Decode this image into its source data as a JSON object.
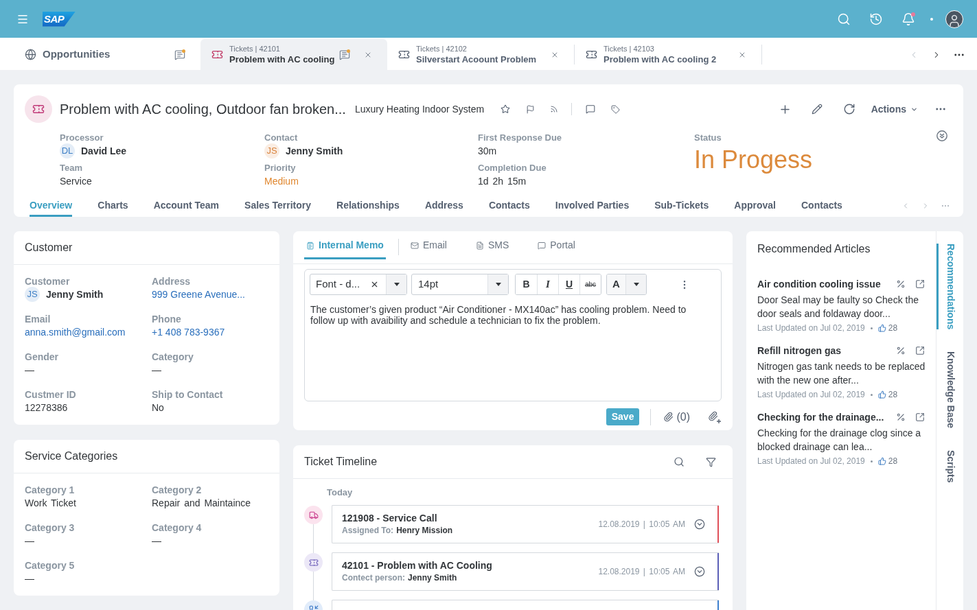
{
  "shell": {
    "logo": "SAP",
    "unread_notifications": true
  },
  "open_tabs": [
    {
      "kind": "home",
      "title": "Opportunities",
      "chat": true,
      "closable": false,
      "selected": false
    },
    {
      "kind": "ticket",
      "overline": "Tickets | 42101",
      "title": "Problem with AC cooling",
      "chat": true,
      "closable": true,
      "selected": true
    },
    {
      "kind": "ticket",
      "overline": "Tickets | 42102",
      "title": "Silverstart Acoount Problem",
      "chat": false,
      "closable": true,
      "selected": false
    },
    {
      "kind": "ticket",
      "overline": "Tickets | 42103",
      "title": "Problem with AC cooling 2",
      "chat": false,
      "closable": true,
      "selected": false
    }
  ],
  "tab_nav": {
    "prev_disabled": true,
    "next_disabled": false
  },
  "header": {
    "title": "Problem with AC cooling, Outdoor fan broken...",
    "subtitle": "Luxury Heating Indoor System",
    "actions": "Actions",
    "field_columns": [
      [
        {
          "label": "Processor",
          "value": "David Lee",
          "kind": "person",
          "initials": "DL",
          "color": "#3f80c6"
        },
        {
          "label": "Team",
          "value": "Service",
          "kind": "text"
        }
      ],
      [
        {
          "label": "Contact",
          "value": "Jenny Smith",
          "kind": "person",
          "initials": "JS",
          "color": "#d9823b"
        },
        {
          "label": "Priority",
          "value": "Medium",
          "kind": "warning"
        }
      ],
      [
        {
          "label": "First Response Due",
          "value": "30m",
          "kind": "text"
        },
        {
          "label": "Completion Due",
          "value": "1d 2h 15m",
          "kind": "text"
        }
      ]
    ],
    "status": {
      "label": "Status",
      "value": "In Progess",
      "kind": "warning"
    }
  },
  "section_tabs": [
    {
      "label": "Overview",
      "selected": true
    },
    {
      "label": "Charts",
      "selected": false
    },
    {
      "label": "Account Team",
      "selected": false
    },
    {
      "label": "Sales Territory",
      "selected": false
    },
    {
      "label": "Relationships",
      "selected": false
    },
    {
      "label": "Address",
      "selected": false
    },
    {
      "label": "Contacts",
      "selected": false
    },
    {
      "label": "Involved Parties",
      "selected": false
    },
    {
      "label": "Sub-Tickets",
      "selected": false
    },
    {
      "label": "Approval",
      "selected": false
    },
    {
      "label": "Contacts",
      "selected": false
    }
  ],
  "customer": {
    "title": "Customer",
    "fields": [
      {
        "label": "Customer",
        "value": "Jenny Smith",
        "kind": "person",
        "initials": "JS",
        "color": "#3f80c6"
      },
      {
        "label": "Address",
        "value": "999 Greene Avenue...",
        "kind": "link"
      },
      {
        "label": "Email",
        "value": "anna.smith@gmail.com",
        "kind": "link"
      },
      {
        "label": "Phone",
        "value": "+1 408 783-9367",
        "kind": "link"
      },
      {
        "label": "Gender",
        "value": "—",
        "kind": "text"
      },
      {
        "label": "Category",
        "value": "—",
        "kind": "text"
      },
      {
        "label": "Custmer ID",
        "value": "12278386",
        "kind": "text"
      },
      {
        "label": "Ship to Contact",
        "value": "No",
        "kind": "text"
      }
    ]
  },
  "service_categories": {
    "title": "Service Categories",
    "fields": [
      {
        "label": "Category 1",
        "value": "Work Ticket",
        "kind": "text"
      },
      {
        "label": "Category 2",
        "value": "Repair and Maintaince",
        "kind": "text"
      },
      {
        "label": "Category 3",
        "value": "—",
        "kind": "text"
      },
      {
        "label": "Category 4",
        "value": "—",
        "kind": "text"
      },
      {
        "label": "Category 5",
        "value": "—",
        "kind": "text"
      }
    ]
  },
  "memo": {
    "tabs": [
      {
        "label": "Internal Memo",
        "kind": "memo",
        "selected": true
      },
      {
        "label": "Email",
        "kind": "email",
        "selected": false
      },
      {
        "label": "SMS",
        "kind": "sms",
        "selected": false
      },
      {
        "label": "Portal",
        "kind": "portal",
        "selected": false
      }
    ],
    "font": "Font - d...",
    "size": "14pt",
    "format_buttons": [
      {
        "label": "B",
        "kind": "bold"
      },
      {
        "label": "I",
        "kind": "italic"
      },
      {
        "label": "U",
        "kind": "underline"
      },
      {
        "label": "abc",
        "kind": "strike"
      }
    ],
    "color_button": "A",
    "text": "The customer’s given product “Air Conditioner - MX140ac” has cooling problem. Need to follow up with avaibility and schedule a technician to fix the problem.",
    "save": "Save",
    "attachments": "(0)"
  },
  "timeline": {
    "title": "Ticket Timeline",
    "group": "Today",
    "items": [
      {
        "kind": "service_call",
        "title": "121908 - Service Call",
        "meta_label": "Assigned To:",
        "meta_value": "Henry Mission",
        "when": "12.08.2019 | 10:05 AM",
        "color": "#e0505a"
      },
      {
        "kind": "ticket",
        "title": "42101 - Problem with AC Cooling",
        "meta_label": "Contect person:",
        "meta_value": "Jenny Smith",
        "when": "12.08.2019 | 10:05 AM",
        "color": "#5b5fb6"
      },
      {
        "kind": "call",
        "color": "#3e7fce"
      }
    ]
  },
  "articles": {
    "title": "Recommended Articles",
    "items": [
      {
        "title": "Air condition cooling issue",
        "text": "Door Seal may be faulty so Check the door seals and foldaway door...",
        "updated": "Last Updated on Jul 02, 2019",
        "likes": "28"
      },
      {
        "title": "Refill nitrogen gas",
        "text": "Nitrogen gas tank needs to be replaced with the new one after...",
        "updated": "Last Updated on Jul 02, 2019",
        "likes": "28"
      },
      {
        "title": "Checking for the drainage...",
        "text": "Checking for the drainage clog since a blocked drainage can lea...",
        "updated": "Last Updated on Jul 02, 2019",
        "likes": "28"
      }
    ]
  },
  "side_tabs": [
    {
      "label": "Recommendations",
      "selected": true
    },
    {
      "label": "Knowledge Base",
      "selected": false
    },
    {
      "label": "Scripts",
      "selected": false
    }
  ]
}
